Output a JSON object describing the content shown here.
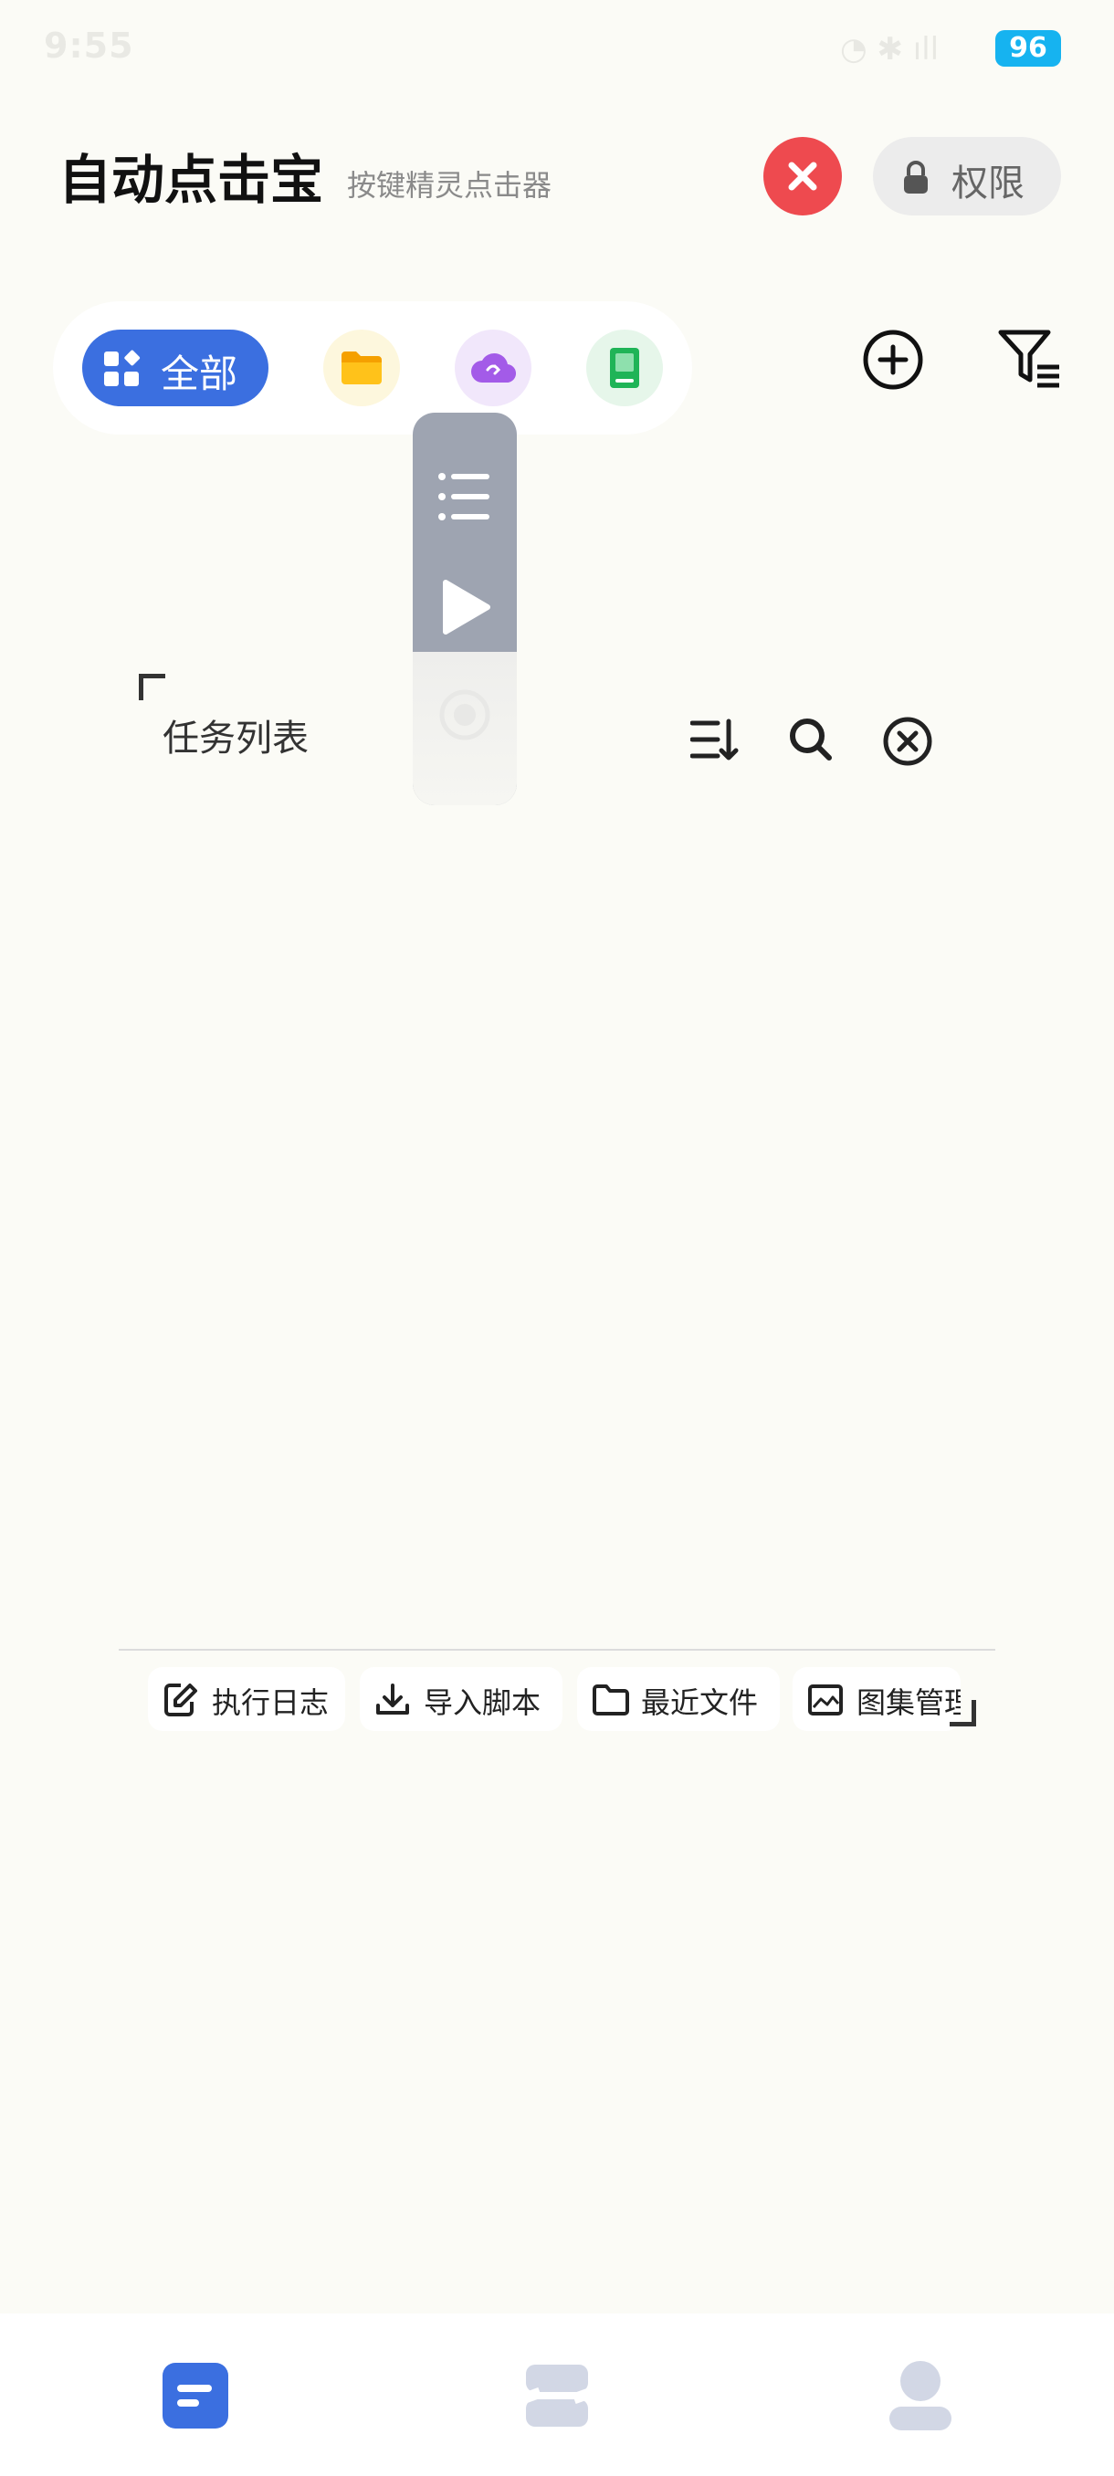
{
  "status": {
    "time": "9:55",
    "battery": "96"
  },
  "header": {
    "title": "自动点击宝",
    "subtitle": "按键精灵点击器",
    "permission_label": "权限"
  },
  "categories": {
    "all_label": "全部"
  },
  "task_list": {
    "title": "任务列表"
  },
  "quick_actions": [
    {
      "label": "执行日志"
    },
    {
      "label": "导入脚本"
    },
    {
      "label": "最近文件"
    },
    {
      "label": "图集管理"
    }
  ],
  "colors": {
    "accent": "#3b6fe0",
    "danger": "#ee4a4f",
    "panel": "#9ea4b1"
  }
}
